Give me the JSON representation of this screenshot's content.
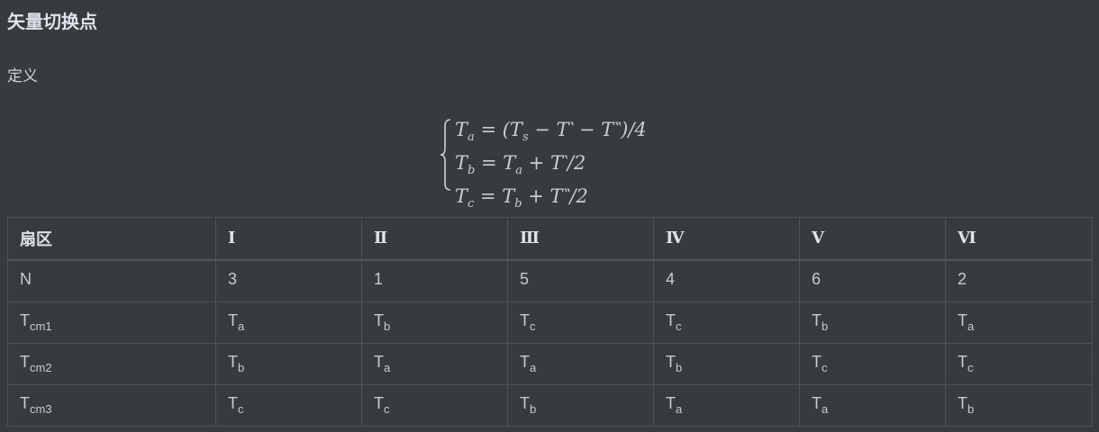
{
  "heading": "矢量切换点",
  "definition_label": "定义",
  "equations": [
    "T_a = (T_s − T‵ − T‶)/4",
    "T_b = T_a + T‵/2",
    "T_c = T_b + T‶/2"
  ],
  "table": {
    "headers": [
      "扇区",
      "Ⅰ",
      "Ⅱ",
      "Ⅲ",
      "Ⅳ",
      "Ⅴ",
      "Ⅵ"
    ],
    "rows": [
      [
        {
          "base": "N",
          "sub": ""
        },
        {
          "base": "3",
          "sub": ""
        },
        {
          "base": "1",
          "sub": ""
        },
        {
          "base": "5",
          "sub": ""
        },
        {
          "base": "4",
          "sub": ""
        },
        {
          "base": "6",
          "sub": ""
        },
        {
          "base": "2",
          "sub": ""
        }
      ],
      [
        {
          "base": "T",
          "sub": "cm1"
        },
        {
          "base": "T",
          "sub": "a"
        },
        {
          "base": "T",
          "sub": "b"
        },
        {
          "base": "T",
          "sub": "c"
        },
        {
          "base": "T",
          "sub": "c"
        },
        {
          "base": "T",
          "sub": "b"
        },
        {
          "base": "T",
          "sub": "a"
        }
      ],
      [
        {
          "base": "T",
          "sub": "cm2"
        },
        {
          "base": "T",
          "sub": "b"
        },
        {
          "base": "T",
          "sub": "a"
        },
        {
          "base": "T",
          "sub": "a"
        },
        {
          "base": "T",
          "sub": "b"
        },
        {
          "base": "T",
          "sub": "c"
        },
        {
          "base": "T",
          "sub": "c"
        }
      ],
      [
        {
          "base": "T",
          "sub": "cm3"
        },
        {
          "base": "T",
          "sub": "c"
        },
        {
          "base": "T",
          "sub": "c"
        },
        {
          "base": "T",
          "sub": "b"
        },
        {
          "base": "T",
          "sub": "a"
        },
        {
          "base": "T",
          "sub": "a"
        },
        {
          "base": "T",
          "sub": "b"
        }
      ]
    ]
  },
  "colors": {
    "background": "#363b40",
    "text": "#c5ccd2",
    "heading": "#dde3e8",
    "border": "#4c5359"
  }
}
